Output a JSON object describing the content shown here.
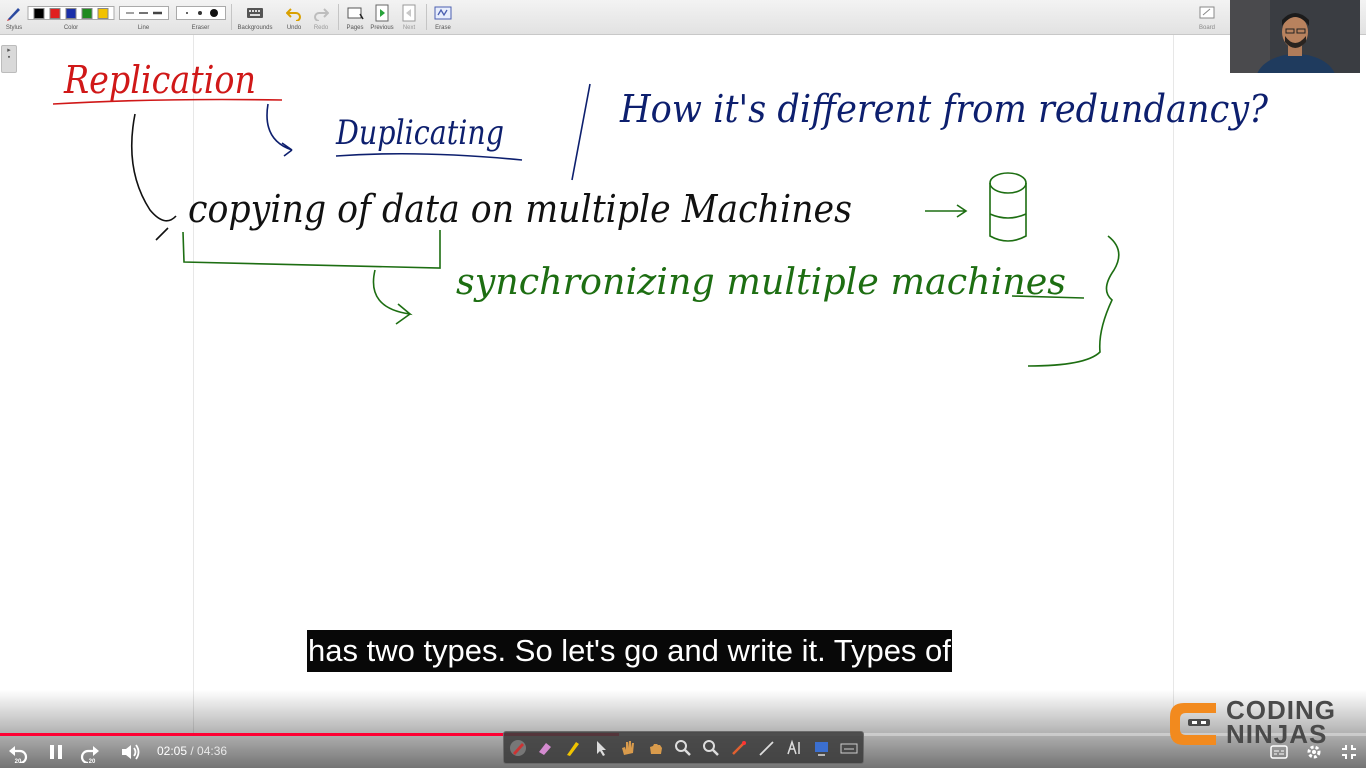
{
  "toolbar": {
    "stylus": "Stylus",
    "color": "Color",
    "line": "Line",
    "eraser": "Eraser",
    "backgrounds": "Backgrounds",
    "undo": "Undo",
    "redo": "Redo",
    "pages": "Pages",
    "previous": "Previous",
    "next": "Next",
    "erase": "Erase",
    "board": "Board",
    "colors": [
      "#000000",
      "#e02020",
      "#1a2fa8",
      "#1e8a1e",
      "#f2c200"
    ]
  },
  "whiteboard": {
    "title": "Replication",
    "line1": "Duplicating",
    "question": "How it's different from redundancy?",
    "line2": "copying of data on multiple Machines",
    "line3": "synchronizing multiple machines",
    "ink": {
      "red": "#d01818",
      "blue": "#0d1f6e",
      "black": "#111111",
      "green": "#1d6e12"
    }
  },
  "caption": "has two types. So let's go and write it. Types of",
  "player": {
    "current_time": "02:05",
    "duration": "04:36",
    "progress": 0.453,
    "rewind_seconds": "20",
    "forward_seconds": "20"
  },
  "brand": {
    "line1": "CODING",
    "line2": "NINJAS"
  }
}
